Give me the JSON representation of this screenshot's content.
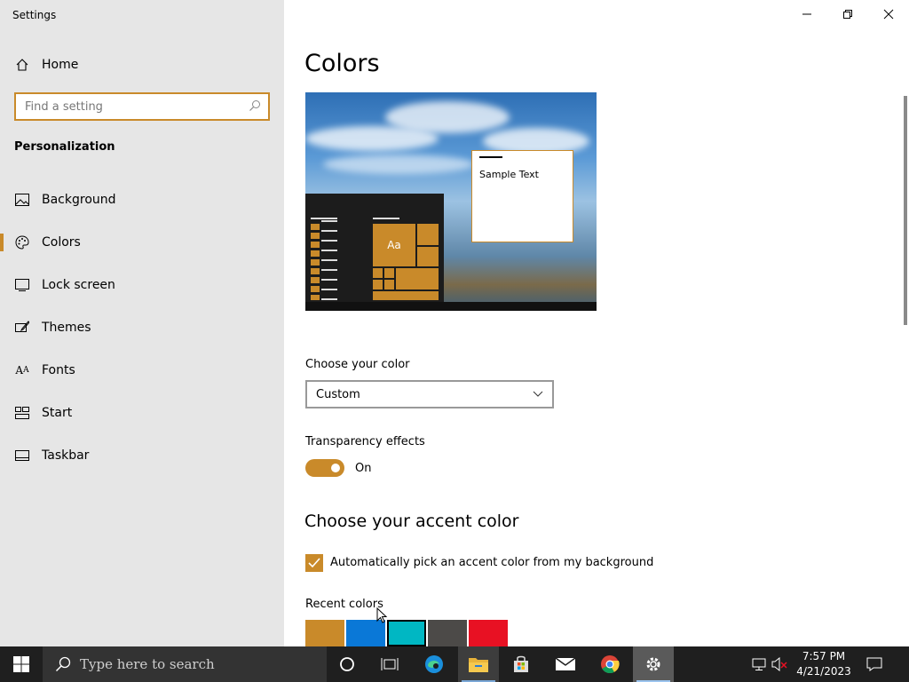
{
  "window": {
    "title": "Settings"
  },
  "sidebar": {
    "home_label": "Home",
    "search_placeholder": "Find a setting",
    "section_label": "Personalization",
    "items": [
      {
        "label": "Background",
        "icon": "image-icon"
      },
      {
        "label": "Colors",
        "icon": "palette-icon",
        "active": true
      },
      {
        "label": "Lock screen",
        "icon": "lock-screen-icon"
      },
      {
        "label": "Themes",
        "icon": "brush-icon"
      },
      {
        "label": "Fonts",
        "icon": "font-icon"
      },
      {
        "label": "Start",
        "icon": "start-tiles-icon"
      },
      {
        "label": "Taskbar",
        "icon": "taskbar-icon"
      }
    ]
  },
  "main": {
    "title": "Colors",
    "preview": {
      "tile_text": "Aa",
      "sample_text": "Sample Text"
    },
    "choose_color": {
      "label": "Choose your color",
      "selected": "Custom"
    },
    "transparency": {
      "label": "Transparency effects",
      "state": "On"
    },
    "accent": {
      "title": "Choose your accent color",
      "auto_pick_label": "Automatically pick an accent color from my background",
      "auto_pick_checked": true,
      "recent_label": "Recent colors",
      "recent_colors": [
        "#c98a2a",
        "#0a78d7",
        "#00b7c3",
        "#4c4a48",
        "#e81123"
      ]
    }
  },
  "taskbar": {
    "search_placeholder": "Type here to search",
    "time": "7:57 PM",
    "date": "4/21/2023"
  },
  "colors": {
    "accent": "#c98a2a",
    "sidebar_bg": "#e6e6e6",
    "taskbar_bg": "#1f1f1f"
  }
}
